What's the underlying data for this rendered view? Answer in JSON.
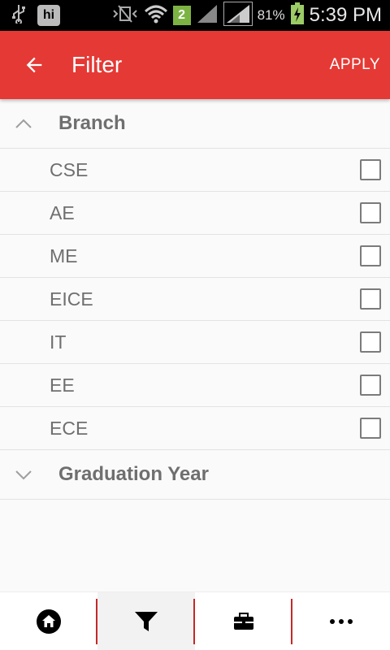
{
  "statusbar": {
    "notif_app": "hi",
    "sim_badge": "2",
    "battery_pct": "81%",
    "time": "5:39 PM"
  },
  "appbar": {
    "title": "Filter",
    "apply_label": "APPLY",
    "background": "#e53935"
  },
  "groups": [
    {
      "label": "Branch",
      "expanded": true,
      "items": [
        {
          "label": "CSE",
          "checked": false
        },
        {
          "label": "AE",
          "checked": false
        },
        {
          "label": "ME",
          "checked": false
        },
        {
          "label": "EICE",
          "checked": false
        },
        {
          "label": "IT",
          "checked": false
        },
        {
          "label": "EE",
          "checked": false
        },
        {
          "label": "ECE",
          "checked": false
        }
      ]
    },
    {
      "label": "Graduation Year",
      "expanded": false,
      "items": []
    }
  ],
  "bottomnav": {
    "items": [
      {
        "icon": "home-icon",
        "active": false
      },
      {
        "icon": "filter-icon",
        "active": true
      },
      {
        "icon": "briefcase-icon",
        "active": false
      },
      {
        "icon": "more-icon",
        "active": false
      }
    ]
  }
}
